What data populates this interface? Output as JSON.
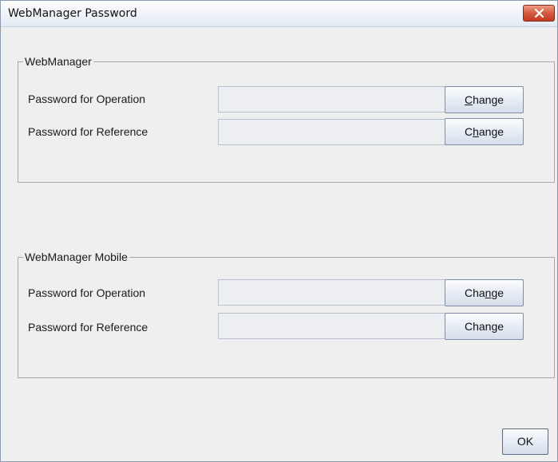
{
  "window": {
    "title": "WebManager Password"
  },
  "groups": [
    {
      "title": "WebManager",
      "rows": [
        {
          "label": "Password for Operation",
          "value": "",
          "button_pre": "",
          "button_mnemonic": "C",
          "button_post": "hange"
        },
        {
          "label": "Password for Reference",
          "value": "",
          "button_pre": "C",
          "button_mnemonic": "h",
          "button_post": "ange"
        }
      ]
    },
    {
      "title": "WebManager Mobile",
      "rows": [
        {
          "label": "Password for Operation",
          "value": "",
          "button_pre": "Cha",
          "button_mnemonic": "n",
          "button_post": "ge"
        },
        {
          "label": "Password for Reference",
          "value": "",
          "button_pre": "Chan",
          "button_mnemonic": "g",
          "button_post": "e"
        }
      ]
    }
  ],
  "footer": {
    "ok_label": "OK"
  },
  "icons": {
    "close": "close-icon"
  },
  "colors": {
    "close_button": "#d25a3f",
    "title_bar": "#eef3f9",
    "background": "#efefef"
  }
}
